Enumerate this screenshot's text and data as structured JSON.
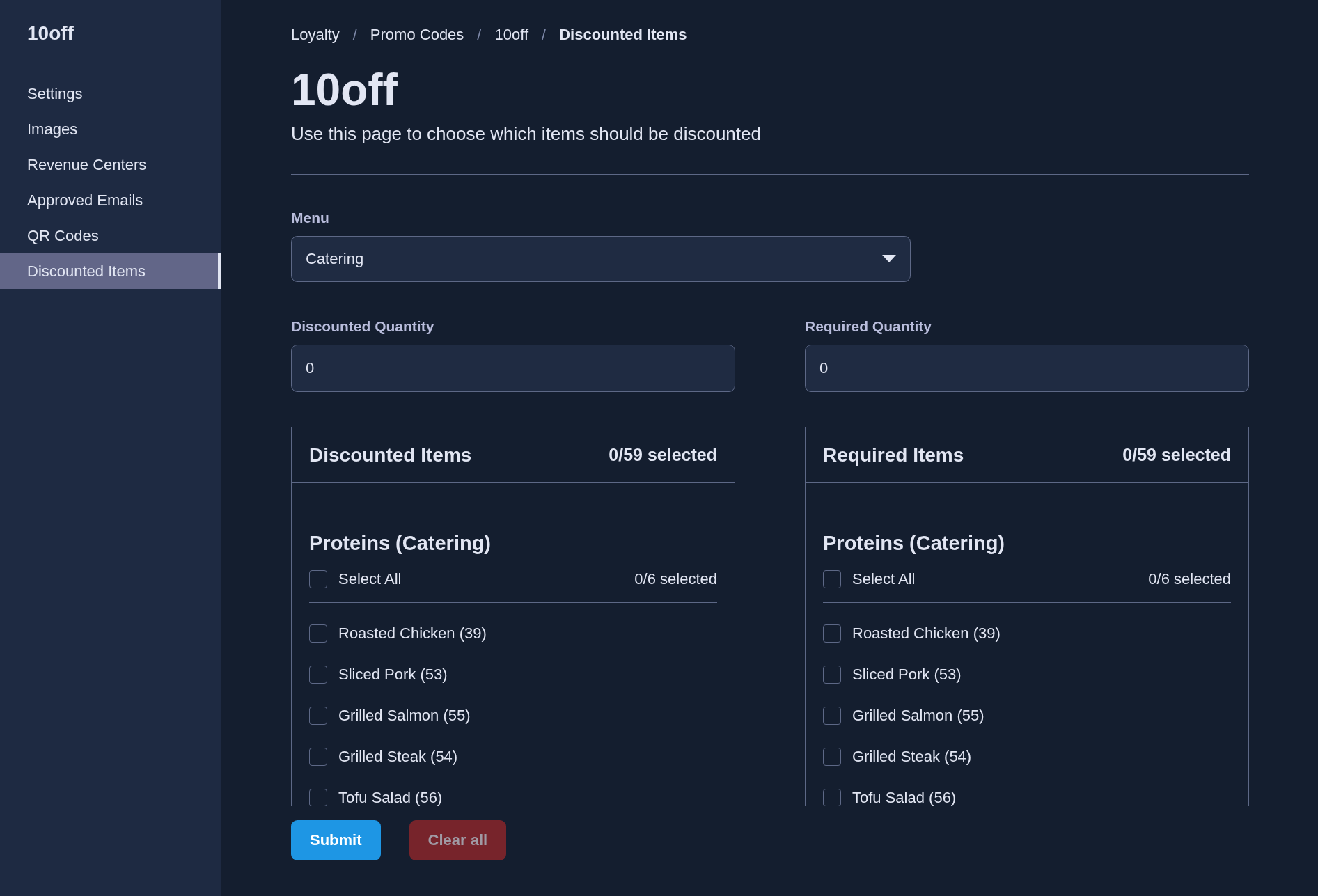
{
  "sidebar": {
    "brand": "10off",
    "items": [
      {
        "label": "Settings",
        "selected": false
      },
      {
        "label": "Images",
        "selected": false
      },
      {
        "label": "Revenue Centers",
        "selected": false
      },
      {
        "label": "Approved Emails",
        "selected": false
      },
      {
        "label": "QR Codes",
        "selected": false
      },
      {
        "label": "Discounted Items",
        "selected": true
      }
    ]
  },
  "breadcrumb": [
    {
      "label": "Loyalty",
      "current": false
    },
    {
      "label": "Promo Codes",
      "current": false
    },
    {
      "label": "10off",
      "current": false
    },
    {
      "label": "Discounted Items",
      "current": true
    }
  ],
  "breadcrumb_separator": "/",
  "page": {
    "title": "10off",
    "subtitle": "Use this page to choose which items should be discounted"
  },
  "menu_field": {
    "label": "Menu",
    "value": "Catering"
  },
  "quantity_fields": [
    {
      "label": "Discounted Quantity",
      "value": "0"
    },
    {
      "label": "Required Quantity",
      "value": "0"
    }
  ],
  "panels": [
    {
      "title": "Discounted Items",
      "count": "0/59 selected",
      "groups": [
        {
          "title": "Proteins (Catering)",
          "select_all": {
            "label": "Select All",
            "checked": false
          },
          "count": "0/6 selected",
          "items": [
            {
              "label": "Roasted Chicken (39)",
              "checked": false
            },
            {
              "label": "Sliced Pork (53)",
              "checked": false
            },
            {
              "label": "Grilled Salmon (55)",
              "checked": false
            },
            {
              "label": "Grilled Steak (54)",
              "checked": false
            },
            {
              "label": "Tofu Salad (56)",
              "checked": false
            }
          ]
        }
      ]
    },
    {
      "title": "Required Items",
      "count": "0/59 selected",
      "groups": [
        {
          "title": "Proteins (Catering)",
          "select_all": {
            "label": "Select All",
            "checked": false
          },
          "count": "0/6 selected",
          "items": [
            {
              "label": "Roasted Chicken (39)",
              "checked": false
            },
            {
              "label": "Sliced Pork (53)",
              "checked": false
            },
            {
              "label": "Grilled Salmon (55)",
              "checked": false
            },
            {
              "label": "Grilled Steak (54)",
              "checked": false
            },
            {
              "label": "Tofu Salad (56)",
              "checked": false
            }
          ]
        }
      ]
    }
  ],
  "buttons": [
    {
      "label": "Submit",
      "kind": "primary",
      "disabled": false
    },
    {
      "label": "Clear all",
      "kind": "danger",
      "disabled": true
    }
  ]
}
